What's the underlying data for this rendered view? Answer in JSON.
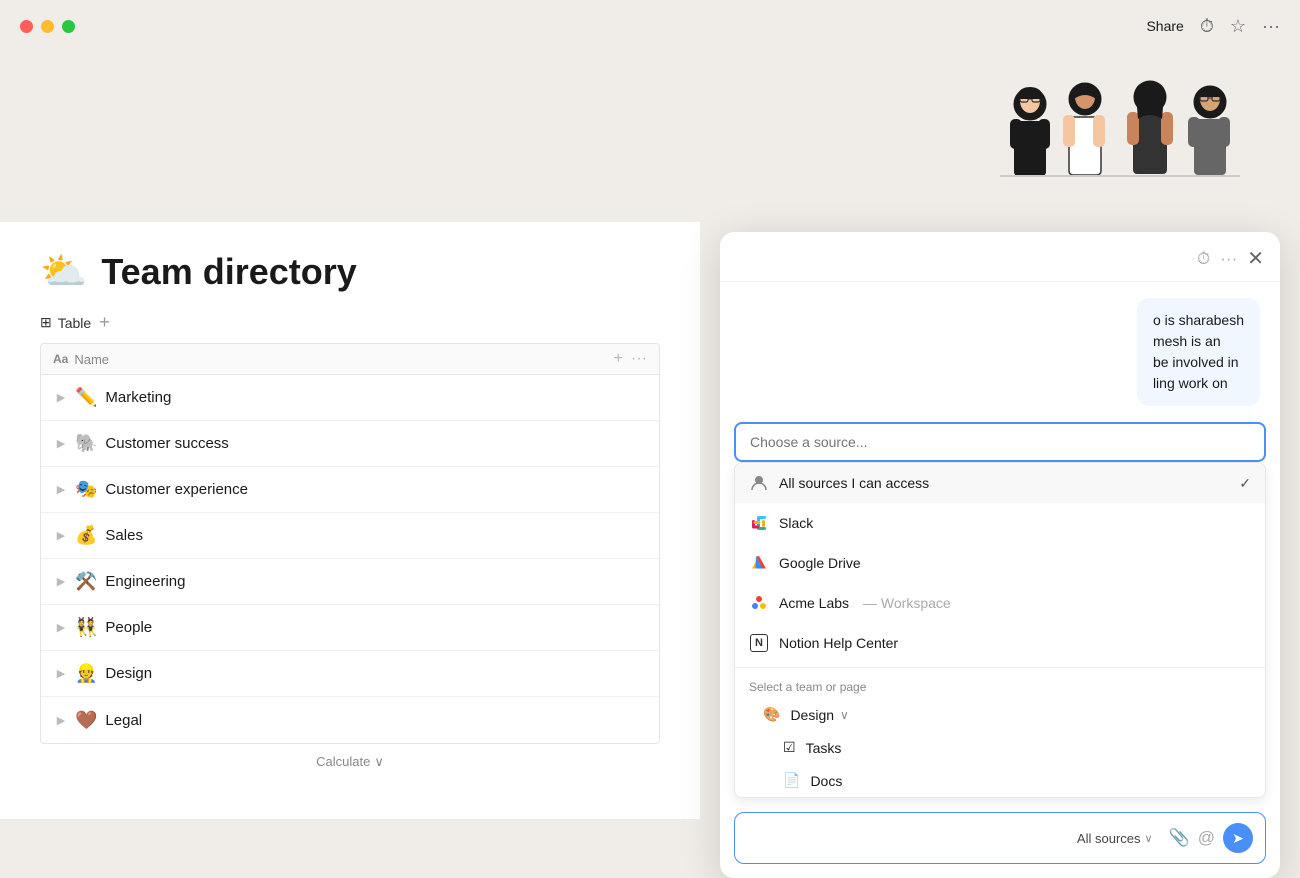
{
  "titlebar": {
    "share_label": "Share",
    "more_options": "···"
  },
  "hero": {
    "illustration_emoji": "👩‍💼👨‍💼👩‍💻👨‍🔬"
  },
  "page": {
    "emoji": "⛅",
    "title": "Team directory",
    "view_label": "Table",
    "add_view_label": "+"
  },
  "table": {
    "column_header": "Name",
    "rows": [
      {
        "emoji": "✏️",
        "name": "Marketing"
      },
      {
        "emoji": "🐘",
        "name": "Customer success"
      },
      {
        "emoji": "🎭",
        "name": "Customer experience"
      },
      {
        "emoji": "💰",
        "name": "Sales"
      },
      {
        "emoji": "⚒️",
        "name": "Engineering"
      },
      {
        "emoji": "👯",
        "name": "People"
      },
      {
        "emoji": "👷",
        "name": "Design"
      },
      {
        "emoji": "🤎",
        "name": "Legal"
      }
    ],
    "calculate_label": "Calculate"
  },
  "chat_popup": {
    "source_search_placeholder": "Choose a source...",
    "sources": [
      {
        "id": "all",
        "label": "All sources I can access",
        "icon": "person",
        "selected": true
      },
      {
        "id": "slack",
        "label": "Slack",
        "icon": "slack"
      },
      {
        "id": "gdrive",
        "label": "Google Drive",
        "icon": "gdrive"
      },
      {
        "id": "acme",
        "label": "Acme Labs",
        "suffix": "— Workspace",
        "icon": "acme"
      },
      {
        "id": "notion",
        "label": "Notion Help Center",
        "icon": "notion"
      }
    ],
    "section_label": "Select a team or page",
    "teams": [
      {
        "id": "design",
        "label": "Design",
        "emoji": "🎨",
        "expanded": true,
        "children": [
          {
            "id": "tasks",
            "label": "Tasks",
            "icon": "checkbox"
          },
          {
            "id": "docs",
            "label": "Docs",
            "icon": "doc"
          }
        ]
      }
    ],
    "message_bubble": {
      "lines": [
        "o is sharabesh",
        "mesh is an",
        "be involved in",
        "ling work on"
      ]
    },
    "input": {
      "source_tag_label": "All sources",
      "send_icon": "➤"
    }
  }
}
